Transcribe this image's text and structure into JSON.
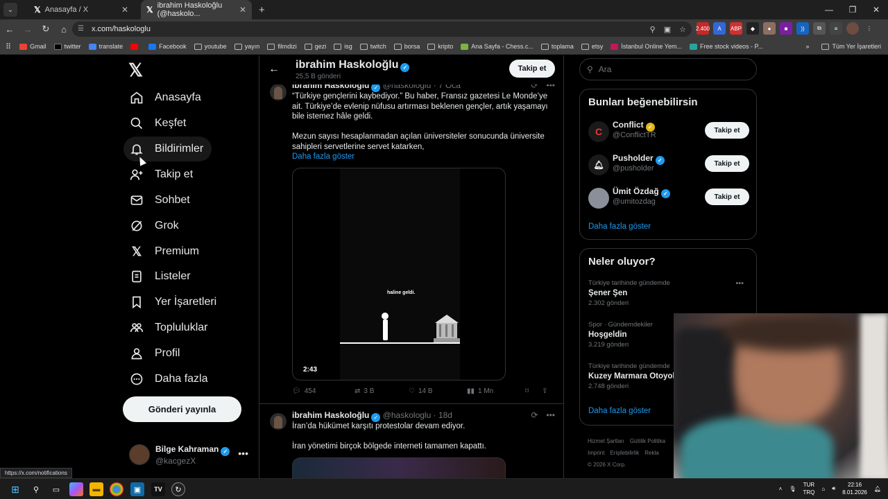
{
  "browser": {
    "tabs": [
      {
        "title": "Anasayfa / X"
      },
      {
        "title": "ibrahim Haskoloğlu (@haskolo..."
      }
    ],
    "url": "x.com/haskologlu",
    "bookmarks": [
      "Gmail",
      "twitter",
      "translate",
      "",
      "Facebook",
      "youtube",
      "yayın",
      "filmdizi",
      "gezi",
      "isg",
      "twitch",
      "borsa",
      "kripto",
      "Ana Sayfa - Chess.c...",
      "toplama",
      "etsy",
      "İstanbul Online Yem...",
      "Free stock videos - P..."
    ],
    "bookmarks_right": "Tüm Yer İşaretleri",
    "ext_badge": "2.400"
  },
  "nav": {
    "items": [
      {
        "label": "Anasayfa",
        "icon": "home-icon"
      },
      {
        "label": "Keşfet",
        "icon": "search-icon"
      },
      {
        "label": "Bildirimler",
        "icon": "bell-icon"
      },
      {
        "label": "Takip et",
        "icon": "follow-icon"
      },
      {
        "label": "Sohbet",
        "icon": "mail-icon"
      },
      {
        "label": "Grok",
        "icon": "grok-icon"
      },
      {
        "label": "Premium",
        "icon": "x-icon"
      },
      {
        "label": "Listeler",
        "icon": "list-icon"
      },
      {
        "label": "Yer İşaretleri",
        "icon": "bookmark-icon"
      },
      {
        "label": "Topluluklar",
        "icon": "communities-icon"
      },
      {
        "label": "Profil",
        "icon": "profile-icon"
      },
      {
        "label": "Daha fazla",
        "icon": "more-circle-icon"
      }
    ],
    "post_button": "Gönderi yayınla",
    "account": {
      "name": "Bilge Kahraman",
      "handle": "@kacgezX"
    }
  },
  "profile_header": {
    "name": "ibrahim Haskoloğlu",
    "post_count": "25,5 B gönderi",
    "follow": "Takip et"
  },
  "tweets": [
    {
      "name": "ibrahim Haskoloğlu",
      "handle": "@haskologlu",
      "time": "· 7 Oca",
      "text1": "“Türkiye gençlerini kaybediyor.” Bu haber, Fransız gazetesi Le Monde’ye ait. Türkiye’de evlenip nüfusu artırması beklenen gençler, artık yaşamayı bile istemez hâle geldi.",
      "text2": "Mezun sayısı hesaplanmadan açılan üniversiteler sonucunda üniversite sahipleri servetlerine servet katarken,",
      "show_more": "Daha fazla göster",
      "video_caption": "haline geldi.",
      "duration": "2:43",
      "replies": "454",
      "reposts": "3 B",
      "likes": "14 B",
      "views": "1 Mn"
    },
    {
      "name": "ibrahim Haskoloğlu",
      "handle": "@haskologlu",
      "time": "· 18d",
      "text1": "İran’da hükümet karşıtı protestolar devam ediyor.",
      "text2": "İran yönetimi birçok bölgede interneti tamamen kapattı."
    }
  ],
  "right": {
    "search_placeholder": "Ara",
    "suggest_title": "Bunları beğenebilirsin",
    "suggestions": [
      {
        "name": "Conflict",
        "handle": "@ConflictTR",
        "btn": "Takip et"
      },
      {
        "name": "Pusholder",
        "handle": "@pusholder",
        "btn": "Takip et"
      },
      {
        "name": "Ümit Özdağ",
        "handle": "@umitozdag",
        "btn": "Takip et"
      }
    ],
    "suggest_more": "Daha fazla göster",
    "trends_title": "Neler oluyor?",
    "trends": [
      {
        "context": "Türkiye tarihinde gündemde",
        "name": "Şener Şen",
        "count": "2.302 gönderi"
      },
      {
        "context": "Spor · Gündemdekiler",
        "name": "Hoşgeldin",
        "count": "3.219 gönderi"
      },
      {
        "context": "Türkiye tarihinde gündemde",
        "name": "Kuzey Marmara Otoyolu",
        "count": "2.748 gönderi"
      }
    ],
    "trends_more": "Daha fazla göster",
    "footer": [
      "Hizmet Şartları",
      "Gizlilik Politika",
      "Imprint",
      "Erişilebilirlik",
      "Rekla",
      "© 2026 X Corp."
    ]
  },
  "status_url": "https://x.com/notifications",
  "taskbar": {
    "lang1": "TUR",
    "lang2": "TRQ",
    "time": "22:16",
    "date": "8.01.2026"
  }
}
